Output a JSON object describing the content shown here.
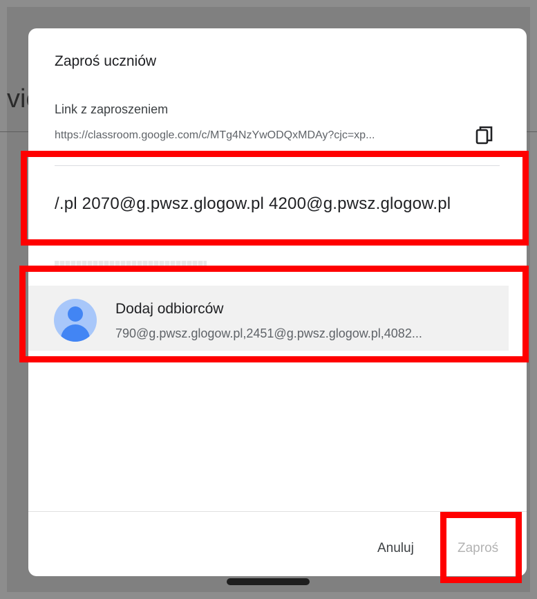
{
  "background": {
    "title_fragment": "vie"
  },
  "dialog": {
    "title": "Zaproś uczniów",
    "invite_link": {
      "label": "Link z zaproszeniem",
      "url": "https://classroom.google.com/c/MTg4NzYwODQxMDAy?cjc=xp...",
      "copy_icon": "copy-icon"
    },
    "email_input": {
      "value": "/.pl 2070@g.pwsz.glogow.pl 4200@g.pwsz.glogow.pl"
    },
    "suggestion": {
      "avatar_icon": "person-avatar-icon",
      "title": "Dodaj odbiorców",
      "subtitle": "790@g.pwsz.glogow.pl,2451@g.pwsz.glogow.pl,4082..."
    },
    "footer": {
      "cancel_label": "Anuluj",
      "invite_label": "Zaproś"
    }
  },
  "colors": {
    "annotation": "#ff0000",
    "avatar_bg": "#a8c7fa",
    "avatar_fg": "#4285f4",
    "disabled_text": "#b3b3b3"
  }
}
